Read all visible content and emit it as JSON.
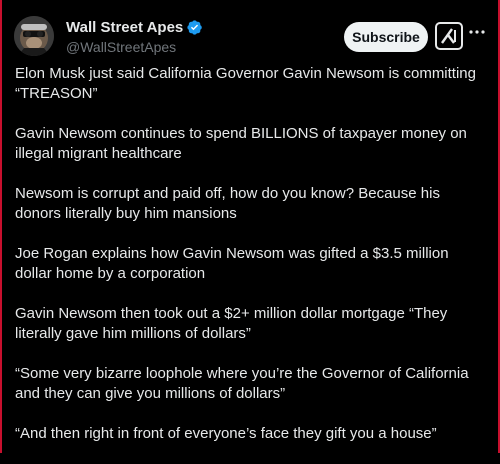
{
  "account": {
    "display_name": "Wall Street Apes",
    "handle": "@WallStreetApes",
    "verified": true,
    "verified_color": "#1d9bf0"
  },
  "actions": {
    "subscribe_label": "Subscribe",
    "grok_icon": "grok-icon",
    "more_icon": "more-horizontal-icon"
  },
  "tweet": {
    "paragraphs": [
      "Elon Musk just said California Governor Gavin Newsom is committing “TREASON”",
      "Gavin Newsom continues to spend BILLIONS of taxpayer money on illegal migrant healthcare",
      "Newsom is corrupt and paid off, how do you know? Because his donors literally buy him mansions",
      "Joe Rogan explains how Gavin Newsom was gifted a $3.5 million dollar home by a corporation",
      "Gavin Newsom then took out a $2+ million dollar mortgage “They literally gave him millions of dollars”",
      "“Some very bizarre loophole where you’re the Governor of California and they can give you millions of dollars”",
      "“And then right in front of everyone’s face they gift you a house”"
    ]
  },
  "colors": {
    "background": "#000000",
    "text": "#e7e9ea",
    "secondary_text": "#71767b",
    "frame_border": "#c8102e"
  }
}
